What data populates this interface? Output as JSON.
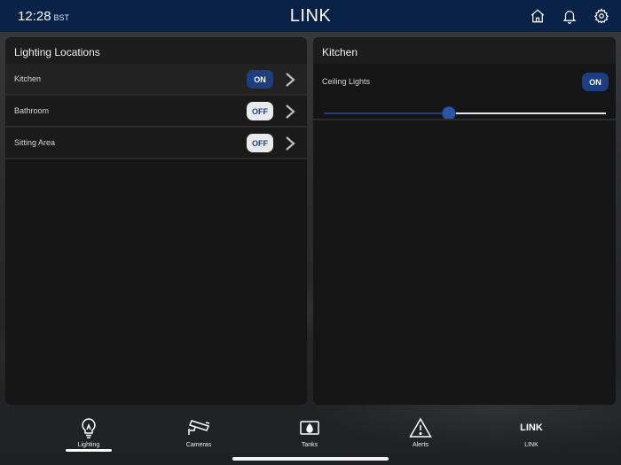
{
  "status": {
    "time": "12:28",
    "zone": "BST"
  },
  "app": {
    "title": "LINK"
  },
  "top_icons": [
    "home-icon",
    "bell-icon",
    "gear-icon"
  ],
  "left_panel": {
    "title": "Lighting Locations",
    "locations": [
      {
        "label": "Kitchen",
        "state": "ON"
      },
      {
        "label": "Bathroom",
        "state": "OFF"
      },
      {
        "label": "Sitting Area",
        "state": "OFF"
      }
    ]
  },
  "right_panel": {
    "title": "Kitchen",
    "light": {
      "label": "Ceiling Lights",
      "state": "ON",
      "level": 0.44
    }
  },
  "nav": [
    {
      "label": "Lighting",
      "icon": "lightbulb-icon",
      "active": true
    },
    {
      "label": "Cameras",
      "icon": "camera-icon"
    },
    {
      "label": "Tanks",
      "icon": "tank-icon"
    },
    {
      "label": "Alerts",
      "icon": "alert-icon"
    },
    {
      "label": "LINK",
      "icon_text": "LINK"
    }
  ],
  "colors": {
    "accent": "#1d3f80",
    "topbar": "#0a2148"
  }
}
